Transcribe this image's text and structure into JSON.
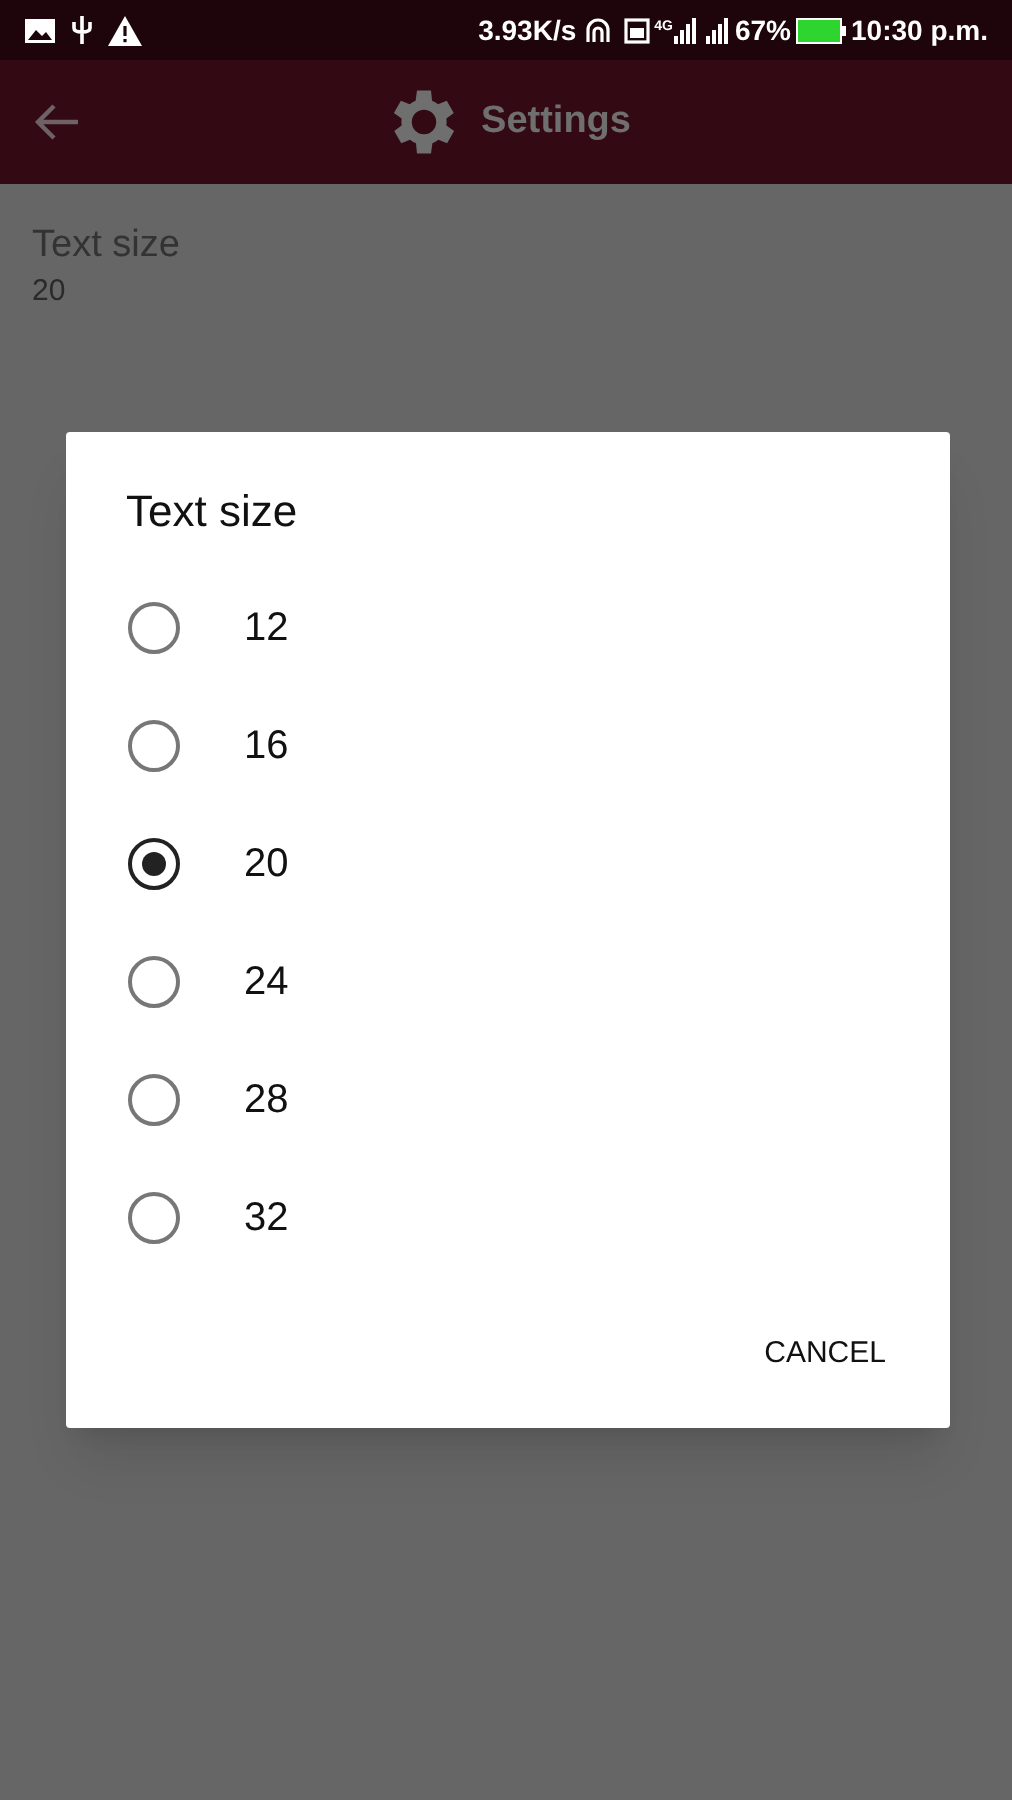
{
  "status_bar": {
    "speed": "3.93K/s",
    "network": "4G",
    "battery": "67%",
    "time": "10:30 p.m."
  },
  "app_bar": {
    "title": "Settings"
  },
  "setting": {
    "title": "Text size",
    "value": "20"
  },
  "dialog": {
    "title": "Text size",
    "options": [
      {
        "label": "12",
        "selected": false
      },
      {
        "label": "16",
        "selected": false
      },
      {
        "label": "20",
        "selected": true
      },
      {
        "label": "24",
        "selected": false
      },
      {
        "label": "28",
        "selected": false
      },
      {
        "label": "32",
        "selected": false
      }
    ],
    "buttons": [
      "CANCEL"
    ]
  }
}
